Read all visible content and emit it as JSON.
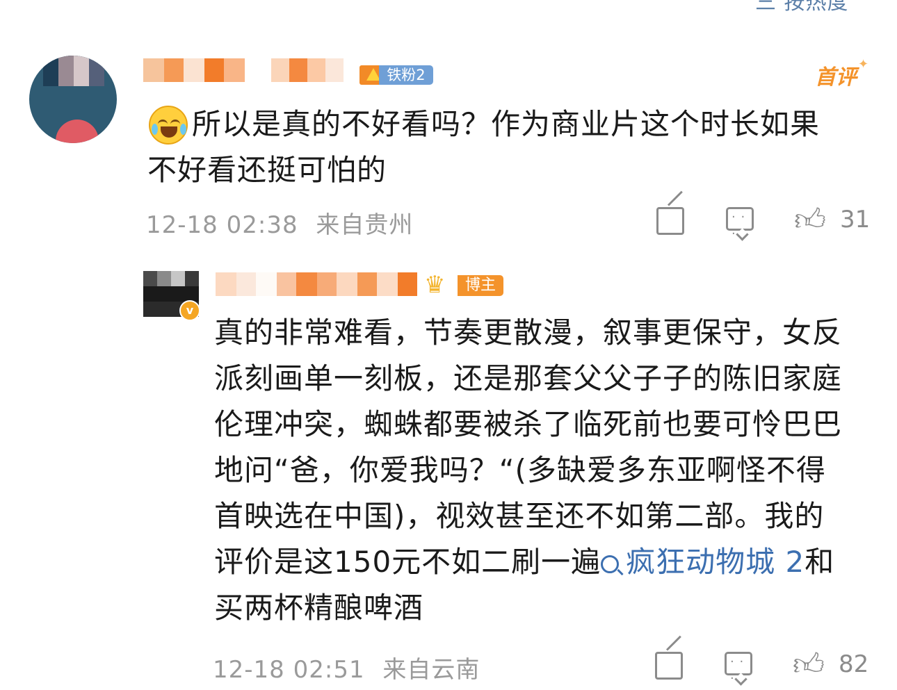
{
  "header": {
    "sort_label": "三 按热度"
  },
  "comments": [
    {
      "fan_badge": "铁粉2",
      "first_badge": "首评",
      "text_line1": "所以是真的不好看吗？作为商业片这个时长如果",
      "text_line2": "不好看还挺可怕的",
      "date": "12-18 02:38",
      "location": "来自贵州",
      "likes": "31",
      "emoji": "laugh-cry-emoji"
    }
  ],
  "reply": {
    "blogger_badge": "博主",
    "verified_badge": "v",
    "text_lines": [
      "真的非常难看，节奏更散漫，叙事更保守，女反",
      "派刻画单一刻板，还是那套父父子子的陈旧家庭",
      "伦理冲突，蜘蛛都要被杀了临死前也要可怜巴巴",
      "地问“爸，你爱我吗？“(多缺爱多东亚啊怪不得",
      "首映选在中国)，视效甚至还不如第二部。我的"
    ],
    "text_line6_prefix": "评价是这150元不如二刷一遍",
    "topic_link": "疯狂动物城 2",
    "text_line6_suffix": "和",
    "text_line7": "买两杯精酿啤酒",
    "date": "12-18 02:51",
    "location": "来自云南",
    "likes": "82"
  },
  "colors": {
    "link": "#3c6fb0",
    "meta": "#9a9a9a",
    "first_badge": "#f4932b",
    "fan_badge": "#6f9fd6"
  }
}
